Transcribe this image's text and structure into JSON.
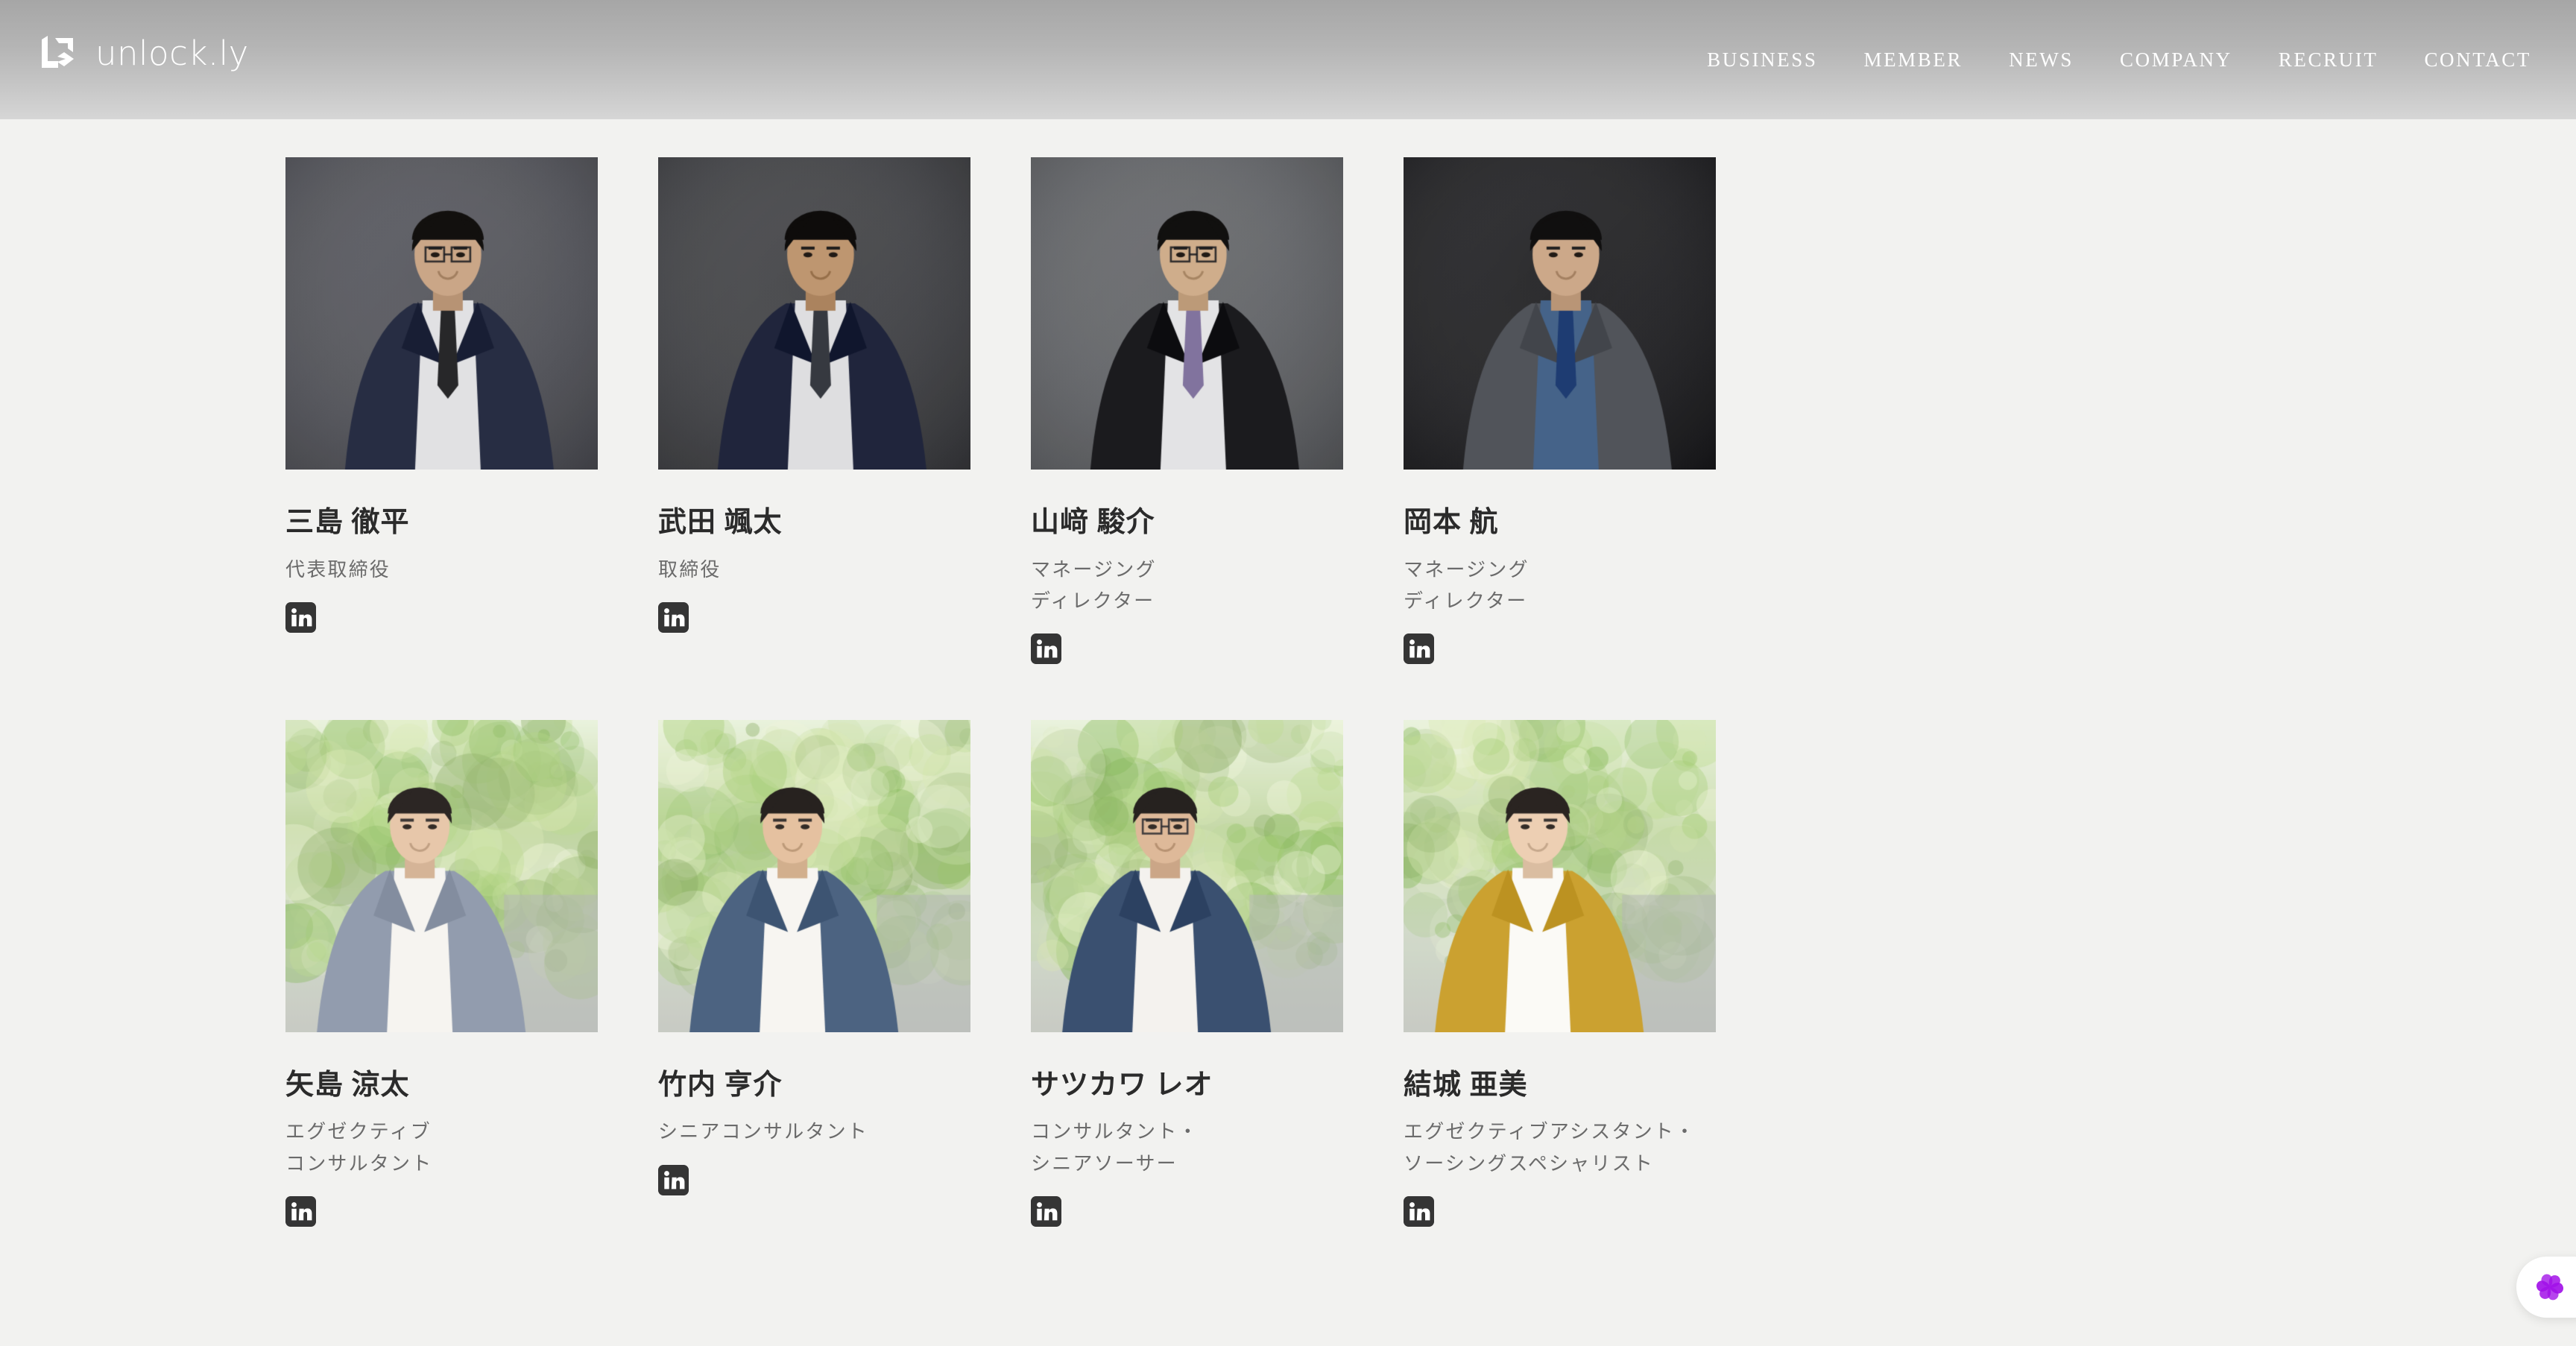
{
  "header": {
    "brand_name": "unlock.ly",
    "logo_icon": "unlockly-logo-mark",
    "nav": [
      {
        "label": "BUSINESS"
      },
      {
        "label": "MEMBER"
      },
      {
        "label": "NEWS"
      },
      {
        "label": "COMPANY"
      },
      {
        "label": "RECRUIT"
      },
      {
        "label": "CONTACT"
      }
    ]
  },
  "members": [
    {
      "name": "三島 徹平",
      "role": "代表取締役",
      "social_icon": "linkedin-icon",
      "photo": {
        "style": "studio",
        "bg": "#5b5c63",
        "suit": "#2a3048",
        "skin": "#d7b190",
        "hair": "#14110f",
        "shirt": "#f0f0f2",
        "tie": "#2a2a2c",
        "glasses": true
      }
    },
    {
      "name": "武田 颯太",
      "role": "取締役",
      "social_icon": "linkedin-icon",
      "photo": {
        "style": "studio",
        "bg": "#46474b",
        "suit": "#222840",
        "skin": "#caa078",
        "hair": "#0f0d0c",
        "shirt": "#ececee",
        "tie": "#3a3d44",
        "glasses": false
      }
    },
    {
      "name": "山﨑 駿介",
      "role": "マネージング\nディレクター",
      "social_icon": "linkedin-icon",
      "photo": {
        "style": "studio",
        "bg": "#6b6d71",
        "suit": "#1d1d20",
        "skin": "#dcb894",
        "hair": "#131110",
        "shirt": "#f2f2f4",
        "tie": "#8a7ba8",
        "glasses": true
      }
    },
    {
      "name": "岡本 航",
      "role": "マネージング\nディレクター",
      "social_icon": "linkedin-icon",
      "photo": {
        "style": "studio",
        "bg": "#232326",
        "suit": "#575a60",
        "skin": "#d9b392",
        "hair": "#121010",
        "shirt": "#4a6a92",
        "tie": "#20407a",
        "glasses": false
      }
    },
    {
      "name": "矢島 涼太",
      "role": "エグゼクティブ\nコンサルタント",
      "social_icon": "linkedin-icon",
      "photo": {
        "style": "outdoor",
        "bg": "#bcd39a",
        "suit": "#8a95a8",
        "skin": "#e6c3a4",
        "hair": "#1c1614",
        "shirt": "#f6f4ef",
        "tie": "",
        "glasses": false
      }
    },
    {
      "name": "竹内 亨介",
      "role": "シニアコンサルタント",
      "social_icon": "linkedin-icon",
      "photo": {
        "style": "outdoor",
        "bg": "#bdd49b",
        "suit": "#3f5878",
        "skin": "#e3bd99",
        "hair": "#17120f",
        "shirt": "#f7f5f0",
        "tie": "",
        "glasses": false
      }
    },
    {
      "name": "サツカワ レオ",
      "role": "コンサルタント・\nシニアソーサー",
      "social_icon": "linkedin-icon",
      "photo": {
        "style": "outdoor",
        "bg": "#c2d7a2",
        "suit": "#2c4366",
        "skin": "#dcb492",
        "hair": "#16120f",
        "shirt": "#f4f2ed",
        "tie": "",
        "glasses": true
      }
    },
    {
      "name": "結城 亜美",
      "role": "エグゼクティブアシスタント・\nソーシングスペシャリスト",
      "social_icon": "linkedin-icon",
      "photo": {
        "style": "outdoor",
        "bg": "#c9dcab",
        "suit": "#c79a21",
        "skin": "#ecccae",
        "hair": "#1a1411",
        "shirt": "#fbfaf6",
        "tie": "",
        "glasses": false
      }
    }
  ],
  "chat_widget": {
    "icon": "chat-assistant-flower-icon",
    "accent": "#a211e8"
  },
  "theme": {
    "page_bg": "#f2f2f0",
    "header_top": "#a6a6a6",
    "header_bottom": "#d6d6d6",
    "name_color": "#2b2b2b",
    "role_color": "#6b6b6b",
    "social_color": "#353535"
  }
}
